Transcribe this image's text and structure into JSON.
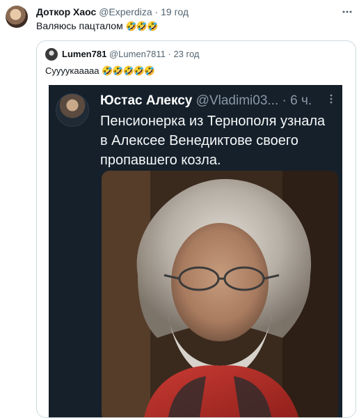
{
  "tweet": {
    "author_name": "Доткор Хаос",
    "author_handle": "@Experdiza",
    "time": "19 год",
    "text": "Валяюсь пацталом",
    "emoji": "🤣🤣🤣"
  },
  "quote": {
    "author_name": "Lumen781",
    "author_handle": "@Lumen7811",
    "time": "23 год",
    "text": "Суууукааааа",
    "emoji": "🤣🤣🤣🤣🤣"
  },
  "inner_tweet": {
    "author_name": "Юстас Алексу",
    "author_handle": "@Vladimi03...",
    "time": "6 ч.",
    "text_lines": [
      "Пенсионерка из Тернополя узнала",
      "в Алексее Венедиктове своего",
      "пропавшего козла."
    ]
  },
  "separator": "·",
  "icons": {
    "more": "more-options-icon"
  }
}
